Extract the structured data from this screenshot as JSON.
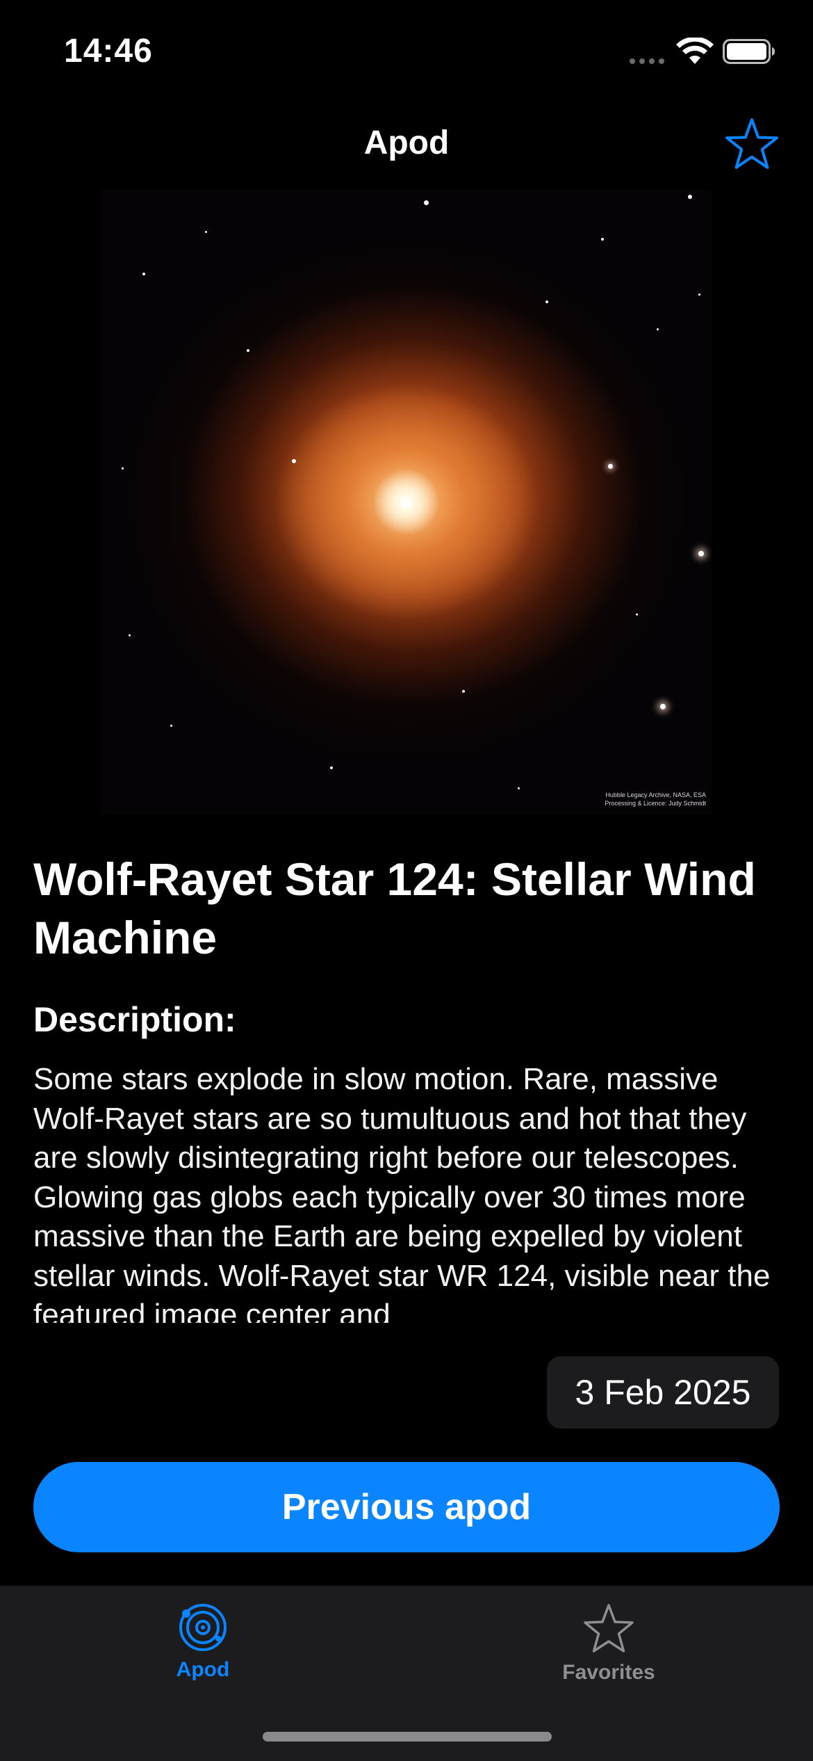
{
  "status_bar": {
    "time": "14:46"
  },
  "nav": {
    "title": "Apod",
    "favorite_icon": "star-outline-icon",
    "accent_color": "#0a84ff"
  },
  "apod": {
    "image_credit_line1": "Hubble Legacy Archive, NASA, ESA",
    "image_credit_line2": "Processing & Licence: Judy Schmidt",
    "title": "Wolf-Rayet Star 124: Stellar Wind Machine",
    "description_heading": "Description:",
    "description": "Some stars explode in slow motion.  Rare, massive Wolf-Rayet stars are so tumultuous and hot that they are slowly disintegrating right before our telescopes.  Glowing gas globs each typically over 30 times more massive than the Earth are being expelled by violent stellar winds.  Wolf-Rayet star WR 124, visible near the featured image center and",
    "date": "3 Feb 2025"
  },
  "actions": {
    "previous_label": "Previous apod"
  },
  "tab_bar": {
    "tabs": [
      {
        "label": "Apod",
        "icon": "orbit-icon",
        "selected": true
      },
      {
        "label": "Favorites",
        "icon": "star-outline-icon",
        "selected": false
      }
    ]
  }
}
